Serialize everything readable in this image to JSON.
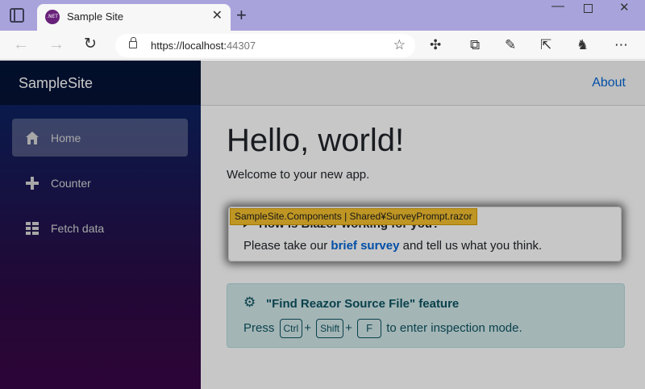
{
  "browser": {
    "tab_title": "Sample Site",
    "tab_favicon_text": ".NET",
    "url_host": "https://localhost:",
    "url_port": "44307",
    "icons": [
      "tab-actions-icon",
      "favicon-dotnet-icon",
      "close-icon",
      "new-tab-icon",
      "minimize-icon",
      "maximize-icon",
      "window-close-icon",
      "back-arrow-icon",
      "forward-arrow-icon",
      "reload-icon",
      "lock-icon",
      "add-favorite-icon",
      "extensions-icon",
      "collections-icon",
      "edit-icon",
      "share-icon",
      "profile-avatar-icon",
      "more-menu-icon"
    ]
  },
  "sidebar": {
    "brand": "SampleSite",
    "items": [
      {
        "label": "Home",
        "icon": "home-icon",
        "active": true
      },
      {
        "label": "Counter",
        "icon": "plus-icon",
        "active": false
      },
      {
        "label": "Fetch data",
        "icon": "list-icon",
        "active": false
      }
    ]
  },
  "main": {
    "about_link": "About",
    "title": "Hello, world!",
    "welcome": "Welcome to your new app.",
    "survey": {
      "heading": "How is Blazor working for you?",
      "text_before": "Please take our ",
      "link_text": "brief survey",
      "text_after": " and tell us what you think."
    },
    "tooltip": "SampleSite.Components | Shared¥SurveyPrompt.razor",
    "feature": {
      "title": "\"Find Reazor Source File\" feature",
      "press": "Press",
      "key_ctrl": "Ctrl",
      "plus1": "+",
      "key_shift": "Shift",
      "plus2": "+",
      "key_f": "F",
      "text_after": "to enter inspection mode."
    }
  },
  "colors": {
    "sidebar_top": "#052767",
    "sidebar_bottom": "#3a0647",
    "link": "#0366d6",
    "tooltip_bg": "#f5c12f",
    "feature_bg": "#d3e8ea",
    "feature_text": "#0c5460",
    "titlebar": "#a9a3dc"
  }
}
